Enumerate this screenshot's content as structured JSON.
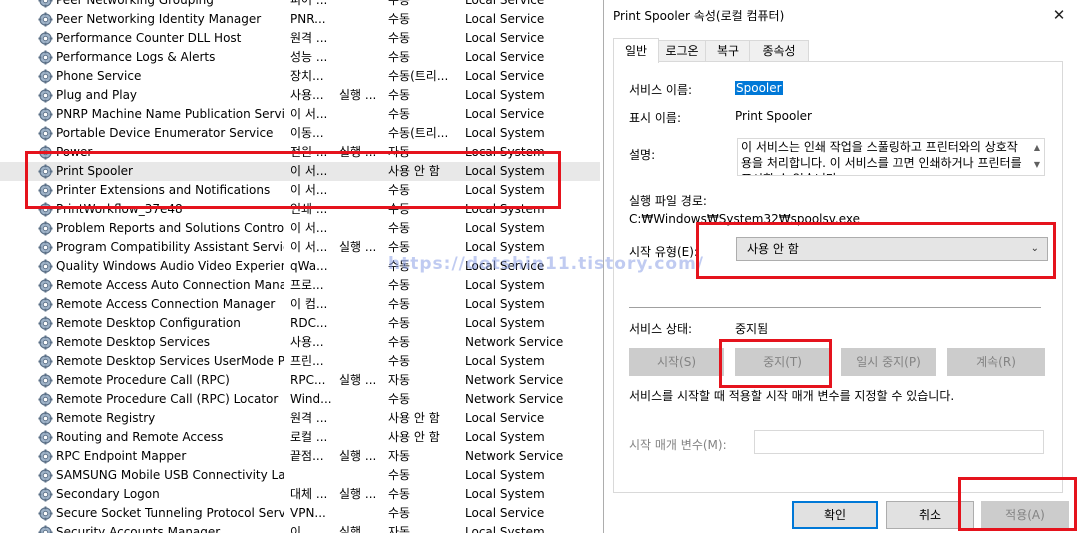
{
  "services": {
    "rows": [
      {
        "name": "Peer Networking Grouping",
        "desc": "피어 ...",
        "status": "",
        "startup": "수동",
        "logon": "Local Service"
      },
      {
        "name": "Peer Networking Identity Manager",
        "desc": "PNR...",
        "status": "",
        "startup": "수동",
        "logon": "Local Service"
      },
      {
        "name": "Performance Counter DLL Host",
        "desc": "원격 ...",
        "status": "",
        "startup": "수동",
        "logon": "Local Service"
      },
      {
        "name": "Performance Logs & Alerts",
        "desc": "성능 ...",
        "status": "",
        "startup": "수동",
        "logon": "Local Service"
      },
      {
        "name": "Phone Service",
        "desc": "장치...",
        "status": "",
        "startup": "수동(트리...",
        "logon": "Local Service"
      },
      {
        "name": "Plug and Play",
        "desc": "사용...",
        "status": "실행 ...",
        "startup": "수동",
        "logon": "Local System"
      },
      {
        "name": "PNRP Machine Name Publication Service",
        "desc": "이 서...",
        "status": "",
        "startup": "수동",
        "logon": "Local Service"
      },
      {
        "name": "Portable Device Enumerator Service",
        "desc": "이동...",
        "status": "",
        "startup": "수동(트리...",
        "logon": "Local System"
      },
      {
        "name": "Power",
        "desc": "전원 ...",
        "status": "실행 ...",
        "startup": "자동",
        "logon": "Local System"
      },
      {
        "name": "Print Spooler",
        "desc": "이 서...",
        "status": "",
        "startup": "사용 안 함",
        "logon": "Local System"
      },
      {
        "name": "Printer Extensions and Notifications",
        "desc": "이 서...",
        "status": "",
        "startup": "수동",
        "logon": "Local System"
      },
      {
        "name": "PrintWorkflow_37e48",
        "desc": "인쇄 ...",
        "status": "",
        "startup": "수동",
        "logon": "Local System"
      },
      {
        "name": "Problem Reports and Solutions Control ...",
        "desc": "이 서...",
        "status": "",
        "startup": "수동",
        "logon": "Local System"
      },
      {
        "name": "Program Compatibility Assistant Service",
        "desc": "이 서...",
        "status": "실행 ...",
        "startup": "수동",
        "logon": "Local System"
      },
      {
        "name": "Quality Windows Audio Video Experience",
        "desc": "qWa...",
        "status": "",
        "startup": "수동",
        "logon": "Local Service"
      },
      {
        "name": "Remote Access Auto Connection Mana...",
        "desc": "프로...",
        "status": "",
        "startup": "수동",
        "logon": "Local System"
      },
      {
        "name": "Remote Access Connection Manager",
        "desc": "이 컴...",
        "status": "",
        "startup": "수동",
        "logon": "Local System"
      },
      {
        "name": "Remote Desktop Configuration",
        "desc": "RDC...",
        "status": "",
        "startup": "수동",
        "logon": "Local System"
      },
      {
        "name": "Remote Desktop Services",
        "desc": "사용...",
        "status": "",
        "startup": "수동",
        "logon": "Network Service"
      },
      {
        "name": "Remote Desktop Services UserMode Por...",
        "desc": "프린...",
        "status": "",
        "startup": "수동",
        "logon": "Local System"
      },
      {
        "name": "Remote Procedure Call (RPC)",
        "desc": "RPC...",
        "status": "실행 ...",
        "startup": "자동",
        "logon": "Network Service"
      },
      {
        "name": "Remote Procedure Call (RPC) Locator",
        "desc": "Wind...",
        "status": "",
        "startup": "수동",
        "logon": "Network Service"
      },
      {
        "name": "Remote Registry",
        "desc": "원격 ...",
        "status": "",
        "startup": "사용 안 함",
        "logon": "Local Service"
      },
      {
        "name": "Routing and Remote Access",
        "desc": "로컬 ...",
        "status": "",
        "startup": "사용 안 함",
        "logon": "Local System"
      },
      {
        "name": "RPC Endpoint Mapper",
        "desc": "끝점...",
        "status": "실행 ...",
        "startup": "자동",
        "logon": "Network Service"
      },
      {
        "name": "SAMSUNG Mobile USB Connectivity La...",
        "desc": "",
        "status": "",
        "startup": "수동",
        "logon": "Local System"
      },
      {
        "name": "Secondary Logon",
        "desc": "대체 ...",
        "status": "실행 ...",
        "startup": "수동",
        "logon": "Local System"
      },
      {
        "name": "Secure Socket Tunneling Protocol Service",
        "desc": "VPN...",
        "status": "",
        "startup": "수동",
        "logon": "Local Service"
      },
      {
        "name": "Security Accounts Manager",
        "desc": "이 ...",
        "status": "실행 ...",
        "startup": "자동",
        "logon": "Local System"
      }
    ]
  },
  "watermark": "https://dotshin11.tistory.com/",
  "dialog": {
    "title": "Print Spooler 속성(로컬 컴퓨터)",
    "close_glyph": "✕",
    "tabs": [
      "일반",
      "로그온",
      "복구",
      "종속성"
    ],
    "service_name_label": "서비스 이름:",
    "service_name": "Spooler",
    "display_name_label": "표시 이름:",
    "display_name": "Print Spooler",
    "description_label": "설명:",
    "description": "이 서비스는 인쇄 작업을 스풀링하고 프린터와의 상호작용을 처리합니다. 이 서비스를 끄면 인쇄하거나 프린터를 표시할 수 없습니다.",
    "exe_path_label": "실행 파일 경로:",
    "exe_path": "C:₩Windows₩System32₩spoolsv.exe",
    "startup_type_label": "시작 유형(E):",
    "startup_type": "사용 안 함",
    "status_label": "서비스 상태:",
    "status": "중지됨",
    "buttons": {
      "start": "시작(S)",
      "stop": "중지(T)",
      "pause": "일시 중지(P)",
      "resume": "계속(R)"
    },
    "help_text": "서비스를 시작할 때 적용할 시작 매개 변수를 지정할 수 있습니다.",
    "start_params_label": "시작 매개 변수(M):",
    "start_params_value": "",
    "ok": "확인",
    "cancel": "취소",
    "apply": "적용(A)"
  },
  "colors": {
    "highlight": "#e5131d",
    "selection": "#0078d7"
  }
}
